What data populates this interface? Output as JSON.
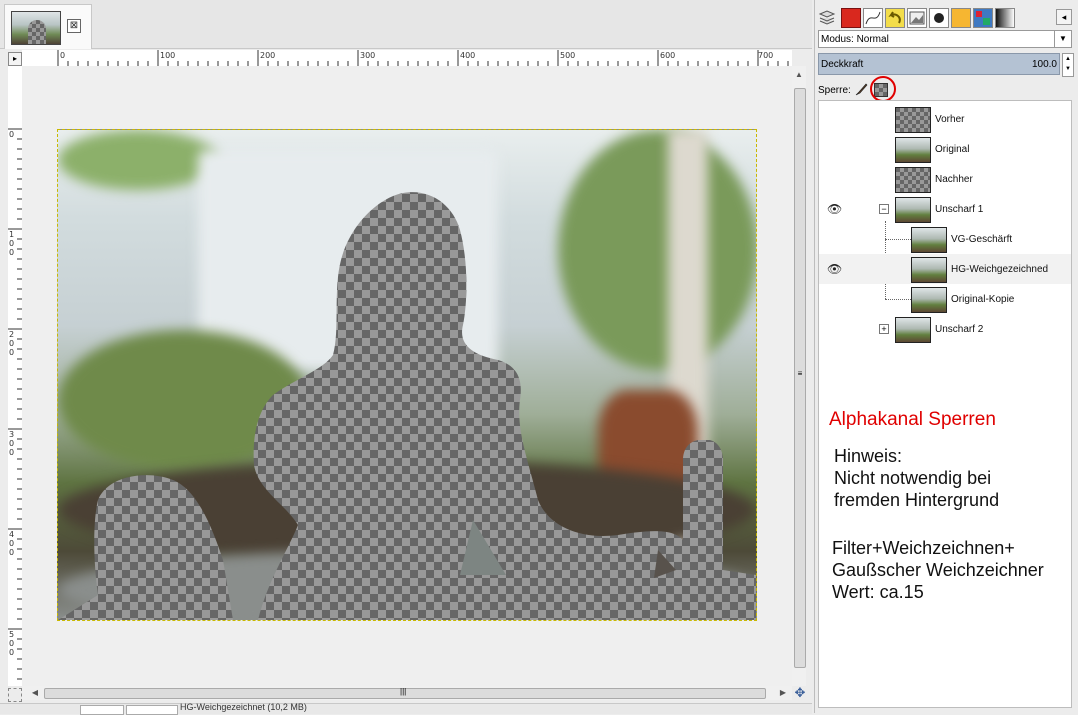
{
  "image_tab": {
    "close_glyph": "⊠",
    "icon": "close-icon"
  },
  "rulers": {
    "horizontal": [
      "0",
      "100",
      "200",
      "300",
      "400",
      "500",
      "600",
      "700"
    ],
    "vertical": [
      "0",
      "100",
      "200",
      "300",
      "400",
      "500"
    ],
    "corner_glyph": "▸"
  },
  "scroll": {
    "vgrip": "≡",
    "hgrip": "|||",
    "up": "▲",
    "down": "▼",
    "left": "◀",
    "right": "▶"
  },
  "status": {
    "text": "HG-Weichgezeichnet (10,2 MB)"
  },
  "dock": {
    "tab_icons": [
      "layers-icon",
      "channels-icon",
      "paths-icon",
      "undo-icon",
      "image-icon",
      "brush-icon",
      "pattern-icon",
      "gradient-icon",
      "fonts-icon"
    ],
    "menu_glyph": "◂",
    "mode_label": "Modus: Normal",
    "opacity_label": "Deckkraft",
    "opacity_value": "100.0",
    "lock_label": "Sperre:"
  },
  "layers": [
    {
      "name": "Vorher",
      "visible": false,
      "thumb": "transparent"
    },
    {
      "name": "Original",
      "visible": false,
      "thumb": "photo"
    },
    {
      "name": "Nachher",
      "visible": false,
      "thumb": "transparent"
    },
    {
      "name": "Unscharf 1",
      "visible": true,
      "thumb": "photo",
      "group": "expanded"
    },
    {
      "name": "VG-Geschärft",
      "visible": false,
      "thumb": "photo"
    },
    {
      "name": "HG-Weichgezeichned",
      "visible": true,
      "thumb": "photo"
    },
    {
      "name": "Original-Kopie",
      "visible": false,
      "thumb": "photo"
    },
    {
      "name": "Unscharf 2",
      "visible": false,
      "thumb": "photo",
      "group": "collapsed"
    }
  ],
  "annotation": {
    "title": "Alphakanal Sperren",
    "hint": "Hinweis:\nNicht notwendig bei\nfremden Hintergrund",
    "filter": "Filter+Weichzeichnen+\nGaußscher Weichzeichner\nWert: ca.15"
  },
  "colors": {
    "accent_red": "#e00000",
    "selection_border": "#c9b800",
    "opacity_bar": "#b4c2d3"
  }
}
